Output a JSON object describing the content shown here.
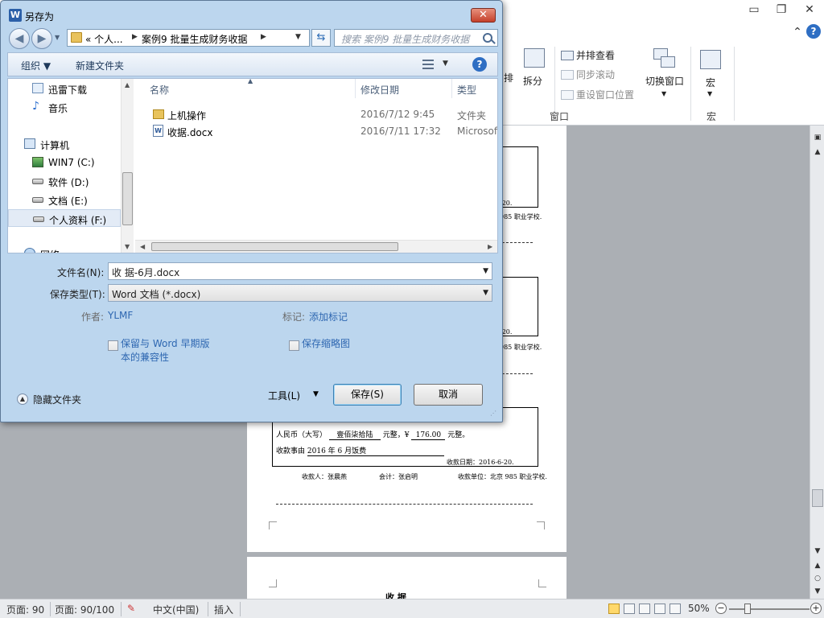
{
  "word": {
    "window_controls": {
      "minimize": "▭",
      "restore": "❐",
      "close": "✕",
      "help": "⌃",
      "help2": "?"
    },
    "ribbon": {
      "side_by_side": "并排查看",
      "sync_scroll": "同步滚动",
      "reset_position": "重设窗口位置",
      "split_partial": "排",
      "split": "拆分",
      "switch_window": "切换窗口",
      "macro": "宏",
      "group_window": "窗口",
      "group_macro": "宏"
    },
    "receipt": {
      "amount_label": "人民币（大写）",
      "amount_words": "壹佰柒拾陆",
      "yuan": "元整，¥",
      "amount_num": "176.00",
      "yuan2": "元整。",
      "reason_label": "收款事由",
      "reason": "2016 年 6 月饭费",
      "date": "收款日期：2016-6-20.",
      "payee": "收款人：张晨燕",
      "accountant": "会计：张启明",
      "unit": "收款单位：北京 985 职业学校.",
      "frag_date": "-20.",
      "frag_unit": "985 职业学校.",
      "next_title": "收    据"
    },
    "status": {
      "page": "页面: 90",
      "pages": "页面: 90/100",
      "language": "中文(中国)",
      "mode": "插入",
      "zoom": "50%",
      "zoom_out": "−",
      "zoom_in": "+"
    }
  },
  "dialog": {
    "title": "另存为",
    "app_icon": "W",
    "close": "✕",
    "nav": {
      "back": "◀",
      "forward": "▶",
      "drop": "▼"
    },
    "breadcrumb": [
      "«  个人...",
      "案例9 批量生成财务收据"
    ],
    "search_placeholder": "搜索 案例9 批量生成财务收据",
    "toolbar": {
      "organize": "组织 ▼",
      "new_folder": "新建文件夹",
      "help": "?"
    },
    "nav_pane": [
      {
        "label": "迅雷下载"
      },
      {
        "label": "音乐"
      },
      {
        "label": "计算机"
      },
      {
        "label": "WIN7 (C:)"
      },
      {
        "label": "软件 (D:)"
      },
      {
        "label": "文档 (E:)"
      },
      {
        "label": "个人资料 (F:)"
      },
      {
        "label": "网络"
      }
    ],
    "columns": {
      "name": "名称",
      "date": "修改日期",
      "type": "类型"
    },
    "files": [
      {
        "name": "上机操作",
        "date": "2016/7/12 9:45",
        "type": "文件夹"
      },
      {
        "name": "收据.docx",
        "date": "2016/7/11 17:32",
        "type": "Microsoft"
      }
    ],
    "form": {
      "filename_label": "文件名(N):",
      "filename_value": "收    据-6月.docx",
      "filetype_label": "保存类型(T):",
      "filetype_value": "Word 文档 (*.docx)",
      "author_label": "作者:",
      "author_value": "YLMF",
      "tags_label": "标记:",
      "tags_value": "添加标记",
      "compat_line1": "保留与 Word 早期版",
      "compat_line2": "本的兼容性",
      "thumbnail": "保存缩略图",
      "hide_folders": "隐藏文件夹",
      "tools": "工具(L)",
      "save": "保存(S)",
      "cancel": "取消"
    }
  }
}
